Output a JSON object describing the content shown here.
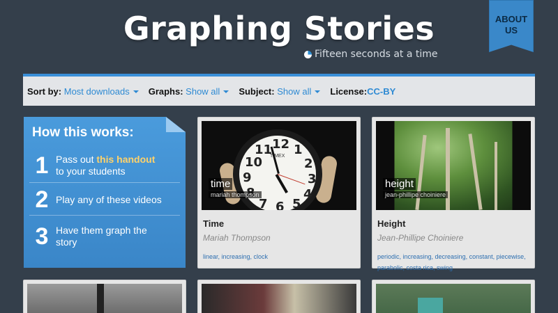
{
  "header": {
    "title": "Graphing Stories",
    "subtitle": "Fifteen seconds at a time",
    "about_line1": "ABOUT",
    "about_line2": "US"
  },
  "filters": {
    "sort_label": "Sort by:",
    "sort_value": "Most downloads",
    "graphs_label": "Graphs:",
    "graphs_value": "Show all",
    "subject_label": "Subject:",
    "subject_value": "Show all",
    "license_label": "License:",
    "license_value": "CC-BY"
  },
  "how": {
    "heading": "How this works:",
    "steps": [
      {
        "num": "1",
        "pre": "Pass out ",
        "link": "this handout",
        "post": "to your students"
      },
      {
        "num": "2",
        "text": "Play any of these videos"
      },
      {
        "num": "3",
        "text": "Have them graph the story"
      }
    ]
  },
  "cards": [
    {
      "overlay_title": "time",
      "overlay_author": "mariah thompson",
      "title": "Time",
      "author": "Mariah Thompson",
      "tags_line1": "linear, increasing, clock",
      "tags_line2": ""
    },
    {
      "overlay_title": "height",
      "overlay_author": "jean-phillipe choiniere",
      "title": "Height",
      "author": "Jean-Phillipe Choiniere",
      "tags_line1": "periodic, increasing, decreasing, constant, piecewise,",
      "tags_line2": "parabolic, costa rica, swing"
    }
  ],
  "clock": {
    "brand": "TIMEX",
    "numbers": [
      "12",
      "1",
      "2",
      "3",
      "4",
      "5",
      "6",
      "7",
      "8",
      "9",
      "10",
      "11"
    ]
  },
  "colors": {
    "background": "#343f4b",
    "accent": "#2e8ad3",
    "filterbar": "#e3e5e8",
    "how_panel": "#4a9bdc",
    "handout_link": "#ffd26a"
  }
}
